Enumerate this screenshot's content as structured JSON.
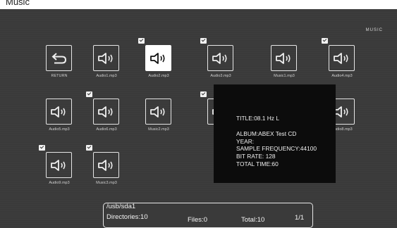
{
  "top_label": "Music",
  "mode_label": "MUSIC",
  "tiles": [
    {
      "label": "RETURN",
      "icon": "return-icon",
      "checked": false,
      "selected": false
    },
    {
      "label": "Audio1.mp3",
      "icon": "speaker-icon",
      "checked": false,
      "selected": false
    },
    {
      "label": "Audio2.mp3",
      "icon": "speaker-icon",
      "checked": true,
      "selected": true
    },
    {
      "label": "Audio3.mp3",
      "icon": "speaker-icon",
      "checked": true,
      "selected": false
    },
    {
      "label": "Music1.mp3",
      "icon": "speaker-icon",
      "checked": false,
      "selected": false
    },
    {
      "label": "Audio4.mp3",
      "icon": "speaker-icon",
      "checked": true,
      "selected": false
    },
    {
      "label": "Audio5.mp3",
      "icon": "speaker-icon",
      "checked": false,
      "selected": false
    },
    {
      "label": "Audio6.mp3",
      "icon": "speaker-icon",
      "checked": true,
      "selected": false
    },
    {
      "label": "Music2.mp3",
      "icon": "speaker-icon",
      "checked": false,
      "selected": false
    },
    {
      "label": "",
      "icon": "speaker-icon",
      "checked": true,
      "selected": false
    },
    {
      "label": "Audio8.mp3",
      "icon": "speaker-icon",
      "checked": false,
      "selected": false
    },
    {
      "label": "Audio9.mp3",
      "icon": "speaker-icon",
      "checked": true,
      "selected": false
    },
    {
      "label": "Music3.mp3",
      "icon": "speaker-icon",
      "checked": true,
      "selected": false
    }
  ],
  "info_panel": {
    "title": "TITLE:08.1 Hz L",
    "album": "ALBUM:ABEX Test CD",
    "year": "YEAR:",
    "sample_frequency": "SAMPLE  FREQUENCY:44100",
    "bit_rate": "BIT RATE: 128",
    "total_time": "TOTAL TIME:60"
  },
  "status": {
    "path": "/usb/sda1",
    "directories": "Directories:10",
    "files": "Files:0",
    "total": "Total:10",
    "page": "1/1"
  },
  "colors": {
    "background": "#3a3a3a",
    "panel": "#0c0c0c",
    "selected_tile": "#ffffff"
  }
}
